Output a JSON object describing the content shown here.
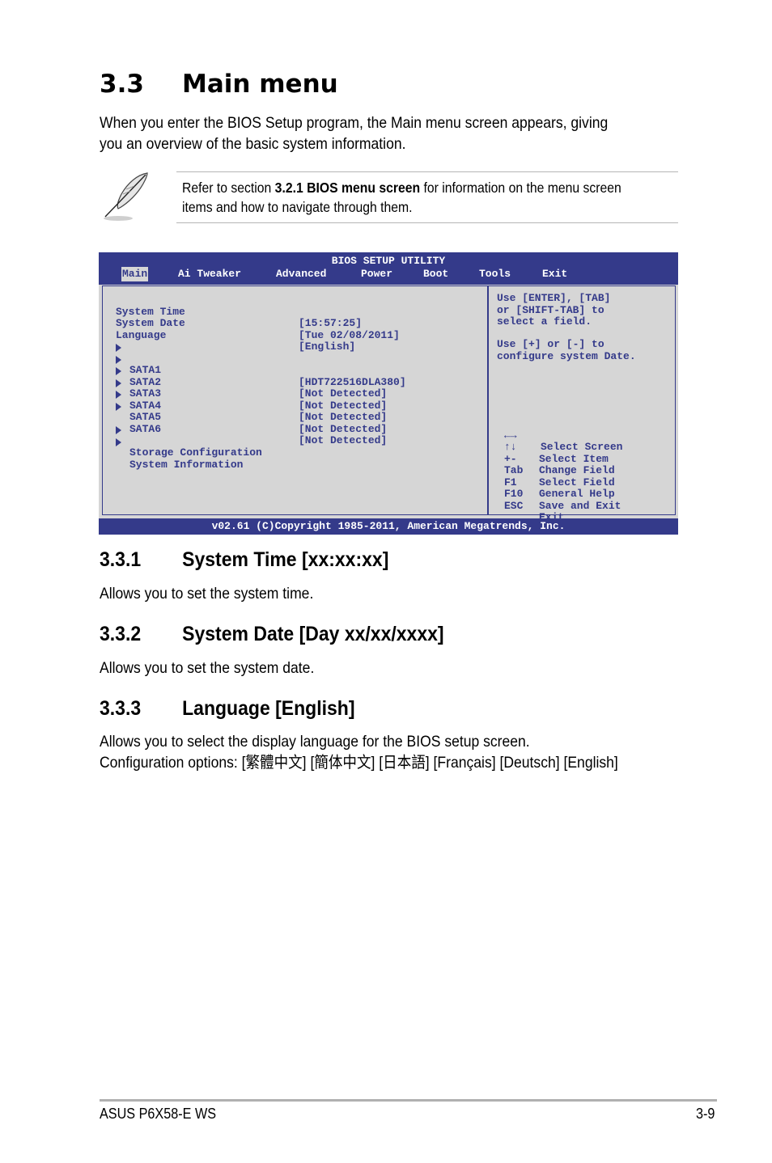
{
  "section": {
    "number": "3.3",
    "title": "Main menu",
    "intro_lines": [
      "When you enter the BIOS Setup program, the Main menu screen appears, giving",
      "you an overview of the basic system information."
    ]
  },
  "note": {
    "icon": "quill-pen-icon",
    "prefix": "Refer to section ",
    "bold": "3.2.1 BIOS menu screen",
    "suffix": " for information on the menu screen",
    "line2": "items and how to navigate through them."
  },
  "bios": {
    "title": "BIOS SETUP UTILITY",
    "tabs": [
      {
        "label": "Main",
        "active": true
      },
      {
        "label": "Ai Tweaker",
        "active": false
      },
      {
        "label": "Advanced",
        "active": false
      },
      {
        "label": "Power",
        "active": false
      },
      {
        "label": "Boot",
        "active": false
      },
      {
        "label": "Tools",
        "active": false
      },
      {
        "label": "Exit",
        "active": false
      }
    ],
    "fields": [
      {
        "label": "System Time",
        "value": "[15:57:25]"
      },
      {
        "label": "System Date",
        "value": "[Tue 02/08/2011]"
      },
      {
        "label": "Language",
        "value": "[English]"
      }
    ],
    "sata": [
      {
        "label": "SATA1",
        "value": "[HDT722516DLA380]"
      },
      {
        "label": "SATA2",
        "value": "[Not Detected]"
      },
      {
        "label": "SATA3",
        "value": "[Not Detected]"
      },
      {
        "label": "SATA4",
        "value": "[Not Detected]"
      },
      {
        "label": "SATA5",
        "value": "[Not Detected]"
      },
      {
        "label": "SATA6",
        "value": "[Not Detected]"
      }
    ],
    "submenus": [
      {
        "label": "Storage Configuration"
      },
      {
        "label": "System Information"
      }
    ],
    "help": [
      "Use [ENTER], [TAB]",
      "or [SHIFT-TAB] to",
      "select a field.",
      "",
      "Use [+] or [-] to",
      "configure system Date."
    ],
    "keys": [
      {
        "key": "←→",
        "desc": "Select Screen"
      },
      {
        "key": "↑↓",
        "desc": "Select Item"
      },
      {
        "key": "+-",
        "desc": "Change Field"
      },
      {
        "key": "Tab",
        "desc": "Select Field"
      },
      {
        "key": "F1",
        "desc": "General Help"
      },
      {
        "key": "F10",
        "desc": "Save and Exit"
      },
      {
        "key": "ESC",
        "desc": "Exit"
      }
    ],
    "footer": "v02.61 (C)Copyright 1985-2011, American Megatrends, Inc.",
    "colors": {
      "bar": "#343a8a",
      "panel": "#d6d6d6",
      "text": "#343a8a"
    }
  },
  "subsections": [
    {
      "number": "3.3.1",
      "title": "System Time [xx:xx:xx]",
      "body": [
        "Allows you to set the system time."
      ]
    },
    {
      "number": "3.3.2",
      "title": "System Date [Day xx/xx/xxxx]",
      "body": [
        "Allows you to set the system date."
      ]
    },
    {
      "number": "3.3.3",
      "title": "Language [English]",
      "body": [
        "Allows you to select the display language for the BIOS setup screen.",
        "Configuration options: [繁體中文] [簡体中文] [日本語] [Français] [Deutsch] [English]"
      ]
    }
  ],
  "footer": {
    "product": "ASUS P6X58-E WS",
    "page": "3-9"
  }
}
